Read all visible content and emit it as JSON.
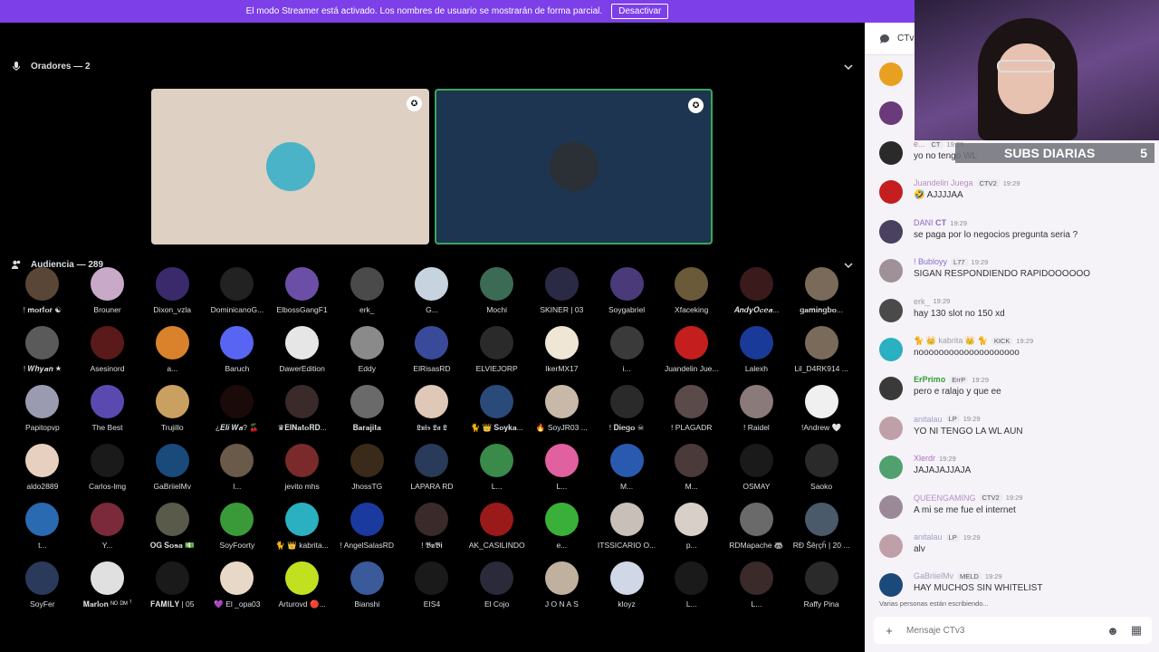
{
  "banner": {
    "text": "El modo Streamer está activado. Los nombres de usuario se mostrarán de forma parcial.",
    "button": "Desactivar",
    "color": "#7d3fe8"
  },
  "speakers": {
    "title": "Oradores — 2",
    "tiles": [
      {
        "bg": "#ded0c3",
        "avatar": "#4bb3c7"
      },
      {
        "bg": "#1d3550",
        "avatar": "#2b2f36",
        "speaking_border": "#3ba55d"
      }
    ]
  },
  "audience": {
    "title": "Audiencia — 289",
    "members": [
      {
        "name": "! 𝐦𝐨𝐫𝐟𝐨𝐫 ☯",
        "color": "#5a4636"
      },
      {
        "name": "Brouner",
        "color": "#c9a9c8"
      },
      {
        "name": "Dixon_vzla",
        "color": "#3b2a6b"
      },
      {
        "name": "DominicanoG...",
        "color": "#222"
      },
      {
        "name": "ElbossGangF1",
        "color": "#6b4fa6"
      },
      {
        "name": "erk_",
        "color": "#4a4a4a"
      },
      {
        "name": "G...",
        "color": "#c7d3de"
      },
      {
        "name": "Mochi",
        "color": "#3c6b55"
      },
      {
        "name": "SKINER | 03",
        "color": "#2a2a44"
      },
      {
        "name": "Soygabriel",
        "color": "#4b3a7a"
      },
      {
        "name": "Xfaceking",
        "color": "#6b5a3a"
      },
      {
        "name": "𝑨𝒏𝒅𝒚𝑶𝒄𝒆𝒂...",
        "color": "#3a1a1a"
      },
      {
        "name": "𝐠𝐚𝐦𝐢𝐧𝐠𝐛𝐨...",
        "color": "#7a6a5a"
      },
      {
        "name": "! 𝑾𝒉𝒚𝒂𝒏 ★",
        "color": "#5a5a5a"
      },
      {
        "name": "Asesinord",
        "color": "#5a1a1a"
      },
      {
        "name": "a...",
        "color": "#d9822b"
      },
      {
        "name": "Baruch",
        "color": "#5865f2"
      },
      {
        "name": "DawerEdition",
        "color": "#e6e6e6"
      },
      {
        "name": "Eddy",
        "color": "#8a8a8a"
      },
      {
        "name": "ElRisasRD",
        "color": "#3a4a9a"
      },
      {
        "name": "ELVIEJORP",
        "color": "#2a2a2a"
      },
      {
        "name": "IkerMX17",
        "color": "#f0e6d6"
      },
      {
        "name": "i...",
        "color": "#3a3a3a"
      },
      {
        "name": "Juandelin Jue...",
        "color": "#c41e1e"
      },
      {
        "name": "Lalexh",
        "color": "#1a3a9a"
      },
      {
        "name": "Lil_D4RK914 ...",
        "color": "#7a6a5a"
      },
      {
        "name": "Papitopvp",
        "color": "#9a9ab0"
      },
      {
        "name": "The Best",
        "color": "#5a4ab0"
      },
      {
        "name": "Trujillo",
        "color": "#c9a060"
      },
      {
        "name": "¿𝑬𝒍𝒊 𝑾𝒂? 🍒",
        "color": "#1a0a0a"
      },
      {
        "name": "♛𝐄𝐥𝐍𝐚𝐭𝐨𝐑𝐃...",
        "color": "#3a2a2a"
      },
      {
        "name": "𝐁𝐚𝐫𝐚𝐣𝐢𝐭𝐚",
        "color": "#6a6a6a"
      },
      {
        "name": "𝕷𝖚𝖎𝖘 𝕷𝖆 𝕷",
        "color": "#e0c8b8"
      },
      {
        "name": "🐈 👑 𝐒𝐨𝐲𝐤𝐚...",
        "color": "#2a4a7a"
      },
      {
        "name": "🔥 SoyJR03 ...",
        "color": "#c8b8a8"
      },
      {
        "name": "! 𝐃𝐢𝐞𝐠𝐨 ☠",
        "color": "#2a2a2a"
      },
      {
        "name": "! PLAGADR",
        "color": "#5a4a4a"
      },
      {
        "name": "! Raidel",
        "color": "#8a7a7a"
      },
      {
        "name": "!Andrew 🤍",
        "color": "#f0f0f0"
      },
      {
        "name": "aldo2889",
        "color": "#e8d0c0"
      },
      {
        "name": "Carlos-lmg",
        "color": "#1a1a1a"
      },
      {
        "name": "GaBriielMv",
        "color": "#1a4a7a"
      },
      {
        "name": "l...",
        "color": "#6a5a4a"
      },
      {
        "name": "jevito mhs",
        "color": "#7a2a2a"
      },
      {
        "name": "JhossTG",
        "color": "#3a2a1a"
      },
      {
        "name": "LAPARA RD",
        "color": "#2a3a5a"
      },
      {
        "name": "L...",
        "color": "#3a8a4a"
      },
      {
        "name": "L...",
        "color": "#e060a0"
      },
      {
        "name": "M...",
        "color": "#2a5ab0"
      },
      {
        "name": "M...",
        "color": "#4a3a3a"
      },
      {
        "name": "OSMAY",
        "color": "#1a1a1a"
      },
      {
        "name": "Saoko",
        "color": "#2a2a2a"
      },
      {
        "name": "t...",
        "color": "#2a6ab0"
      },
      {
        "name": "Y...",
        "color": "#7a2a3a"
      },
      {
        "name": "𝐎𝐆 𝐒𝐨𝐬𝐚 💵",
        "color": "#5a5a4a"
      },
      {
        "name": "SoyFoorty",
        "color": "#3a9a3a"
      },
      {
        "name": "🐈 👑 kabrita...",
        "color": "#2ab0c0"
      },
      {
        "name": "! AngelSalasRD",
        "color": "#1a3aa0"
      },
      {
        "name": "! 𝕭𝖚𝕭𝖎",
        "color": "#3a2a2a"
      },
      {
        "name": "AK_CASILINDO",
        "color": "#9a1a1a"
      },
      {
        "name": "e...",
        "color": "#3ab03a"
      },
      {
        "name": "ITSSICARIO O...",
        "color": "#c8c0b8"
      },
      {
        "name": "p...",
        "color": "#d8d0c8"
      },
      {
        "name": "RDMapache 🦝",
        "color": "#6a6a6a"
      },
      {
        "name": "RĐ Šěŗçĥ | 20 ...",
        "color": "#4a5a6a"
      },
      {
        "name": "SoyFer",
        "color": "#2a3a5a"
      },
      {
        "name": "𝐌𝐚𝐫𝐥𝐨𝐧 ᴺᴼ ᴰᴹ ꜝ",
        "color": "#e0e0e0"
      },
      {
        "name": "𝐅𝐀𝐌𝐈𝐋𝐘 | 05",
        "color": "#1a1a1a"
      },
      {
        "name": "💜 El _opa03",
        "color": "#e8d8c8"
      },
      {
        "name": "Arturovd 🔴...",
        "color": "#c0e020"
      },
      {
        "name": "Bianshi",
        "color": "#3a5a9a"
      },
      {
        "name": "EIS4",
        "color": "#1a1a1a"
      },
      {
        "name": "El Cojo",
        "color": "#2a2a3a"
      },
      {
        "name": "J O N A S",
        "color": "#c0b0a0"
      },
      {
        "name": "kloyz",
        "color": "#d0d8e8"
      },
      {
        "name": "L...",
        "color": "#1a1a1a"
      },
      {
        "name": "L...",
        "color": "#3a2a2a"
      },
      {
        "name": "Raffy Pina",
        "color": "#2a2a2a"
      }
    ]
  },
  "chat": {
    "channel": "CTv3",
    "messages": [
      {
        "user": "e...",
        "user_color": "#a77ba8",
        "tag": "CT",
        "time": "19:29",
        "text": "yo no tengo WL",
        "avatar": "#2a2a2a"
      },
      {
        "user": "Juandelin Juega",
        "user_color": "#b68ec0",
        "tag": "CTV2",
        "time": "19:29",
        "text": "🤣 AJJJJAA",
        "avatar": "#c41e1e"
      },
      {
        "user": "DANI 𝐂𝐓",
        "user_color": "#8a6cc4",
        "tag": "",
        "time": "19:29",
        "text": "se paga por lo negocios pregunta seria ?",
        "avatar": "#4a4060"
      },
      {
        "user": "! Bubloyy",
        "user_color": "#8a6cc4",
        "tag": "L77",
        "time": "19:29",
        "text": "SIGAN RESPONDIENDO RAPIDOOOOOO",
        "avatar": "#a09098"
      },
      {
        "user": "erk_",
        "user_color": "#9a9aa0",
        "tag": "",
        "time": "19:29",
        "text": "hay 130 slot no 150 xd",
        "avatar": "#4a4a4a"
      },
      {
        "user": "🐈 👑 kabrita 👑 🐈",
        "user_color": "#a0a0a8",
        "tag": "KICK",
        "time": "19:29",
        "text": "noooooooooooooooooooo",
        "avatar": "#2ab0c0"
      },
      {
        "user": "𝐄𝐫𝐏𝐫𝐢𝐦𝐨",
        "user_color": "#3aa03a",
        "tag": "ErrP",
        "time": "19:29",
        "text": "pero e ralajo  y que ee",
        "avatar": "#3a3a3a"
      },
      {
        "user": "anitalau",
        "user_color": "#a0a0c8",
        "tag": "LP",
        "time": "19:29",
        "text": "YO NI TENGO LA WL AUN",
        "avatar": "#c0a0a8"
      },
      {
        "user": "Xlerdr",
        "user_color": "#b070c0",
        "tag": "",
        "time": "19:29",
        "text": "JAJAJAJJAJA",
        "avatar": "#50a070"
      },
      {
        "user": "QUEENGAMING",
        "user_color": "#b68ec0",
        "tag": "CTV2",
        "time": "19:29",
        "text": "A mi se me fue el internet",
        "avatar": "#9a8a98"
      },
      {
        "user": "anitalau",
        "user_color": "#a0a0c8",
        "tag": "LP",
        "time": "19:29",
        "text": "alv",
        "avatar": "#c0a0a8"
      },
      {
        "user": "GaBriielMv",
        "user_color": "#a0a0b8",
        "tag": "MELD",
        "time": "19:29",
        "text": "HAY MUCHOS SIN WHITELIST",
        "avatar": "#1a4a7a"
      }
    ],
    "typing": "Varias personas están escribiendo...",
    "placeholder": "Mensaje CTv3"
  },
  "overlay": {
    "label": "SUBS DIARIAS",
    "count": "5"
  }
}
